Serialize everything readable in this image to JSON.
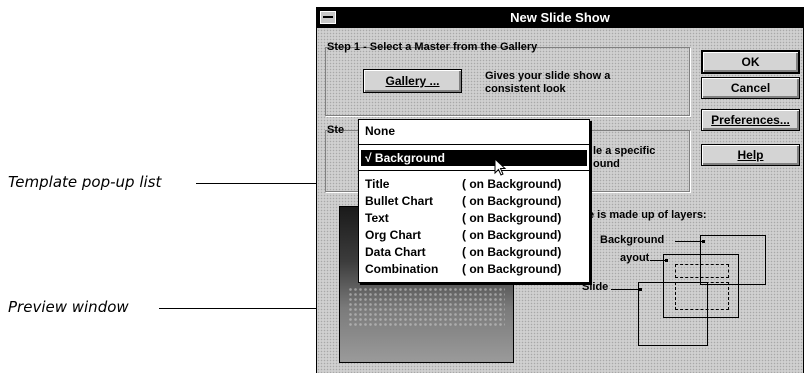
{
  "callouts": {
    "template_popup": "Template pop-up list",
    "preview_window": "Preview window"
  },
  "dialog": {
    "title": "New Slide Show",
    "step1": {
      "label": "Step 1 - Select a Master from the Gallery",
      "gallery_button": "Gallery ...",
      "description": "Gives your slide show a consistent look"
    },
    "step2": {
      "label_partial": "Ste",
      "description_partial_line1": "le a specific",
      "description_partial_line2": "ound"
    },
    "buttons": {
      "ok": "OK",
      "cancel": "Cancel",
      "preferences": "Preferences...",
      "help": "Help"
    },
    "layers": {
      "caption_partial": "e is made up of layers:",
      "background": "Background",
      "layout_partial": "ayout",
      "slide": "Slide"
    }
  },
  "popup": {
    "none": "None",
    "selected": "√ Background",
    "items": [
      {
        "name": "Title",
        "suffix": "( on Background)"
      },
      {
        "name": "Bullet Chart",
        "suffix": "( on Background)"
      },
      {
        "name": "Text",
        "suffix": "( on Background)"
      },
      {
        "name": "Org Chart",
        "suffix": "( on Background)"
      },
      {
        "name": "Data Chart",
        "suffix": "( on Background)"
      },
      {
        "name": "Combination",
        "suffix": "( on Background)"
      }
    ]
  },
  "icons": {
    "system_menu": "system-menu-icon",
    "cursor": "arrow-cursor-icon"
  }
}
